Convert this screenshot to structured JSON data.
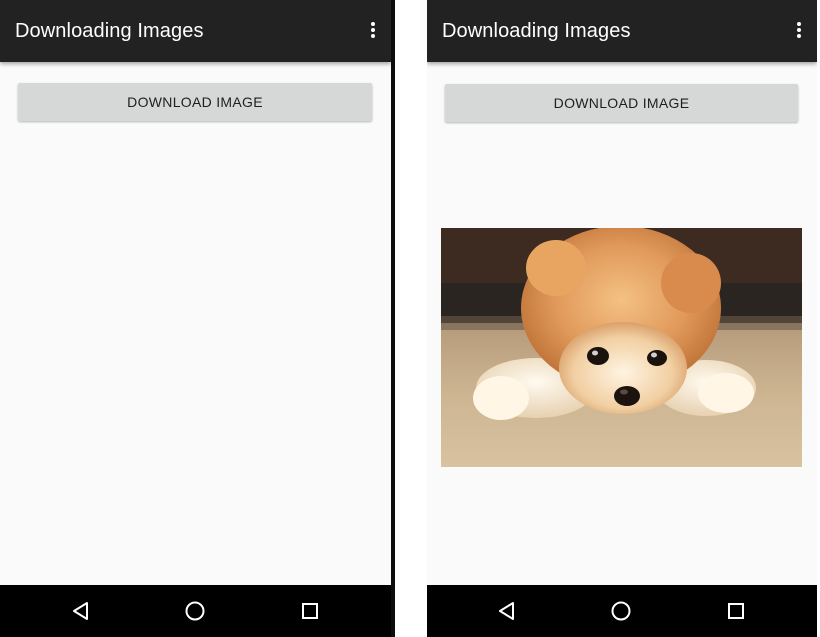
{
  "screens": [
    {
      "app_bar": {
        "title": "Downloading Images",
        "overflow_icon": "more-vert-icon"
      },
      "button": {
        "label": "DOWNLOAD IMAGE"
      },
      "image_visible": false,
      "nav": {
        "back": "back-triangle-icon",
        "home": "home-circle-icon",
        "recents": "recents-square-icon"
      }
    },
    {
      "app_bar": {
        "title": "Downloading Images",
        "overflow_icon": "more-vert-icon"
      },
      "button": {
        "label": "DOWNLOAD IMAGE"
      },
      "image_visible": true,
      "image_subject": "pomeranian-puppy-photo",
      "nav": {
        "back": "back-triangle-icon",
        "home": "home-circle-icon",
        "recents": "recents-square-icon"
      }
    }
  ],
  "colors": {
    "app_bar": "#222222",
    "background": "#fafafa",
    "button": "#d6d7d7",
    "nav_bar": "#000000"
  }
}
